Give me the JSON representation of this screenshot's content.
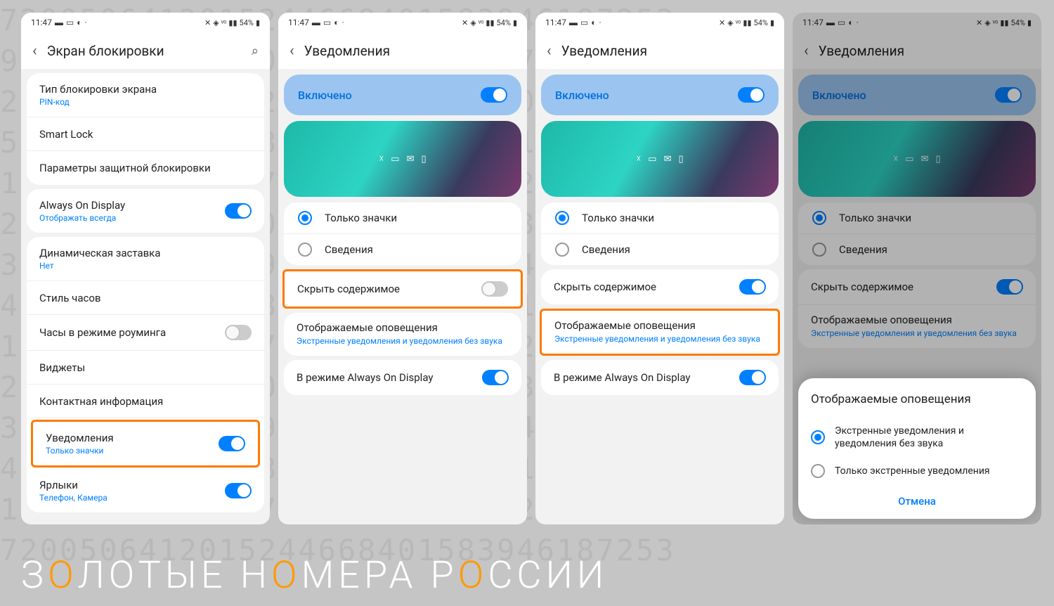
{
  "statusbar": {
    "time": "11:47",
    "battery": "54%"
  },
  "screen1": {
    "title": "Экран блокировки",
    "items": {
      "lock_type": {
        "title": "Тип блокировки экрана",
        "sub": "PIN-код"
      },
      "smart_lock": "Smart Lock",
      "secure_params": "Параметры защитной блокировки",
      "aod": {
        "title": "Always On Display",
        "sub": "Отображать всегда"
      },
      "dynamic": {
        "title": "Динамическая заставка",
        "sub": "Нет"
      },
      "clock_style": "Стиль часов",
      "roaming_clock": "Часы в режиме роуминга",
      "widgets": "Виджеты",
      "contact_info": "Контактная информация",
      "notifications": {
        "title": "Уведомления",
        "sub": "Только значки"
      },
      "shortcuts": {
        "title": "Ярлыки",
        "sub": "Телефон, Камера"
      }
    }
  },
  "notif_screen": {
    "title": "Уведомления",
    "enabled": "Включено",
    "radio_icons": "Только значки",
    "radio_details": "Сведения",
    "hide_content": "Скрыть содержимое",
    "shown_alerts": {
      "title": "Отображаемые оповещения",
      "sub": "Экстренные уведомления и уведомления без звука"
    },
    "aod_mode": "В режиме Always On Display"
  },
  "dialog": {
    "title": "Отображаемые оповещения",
    "opt1": "Экстренные уведомления и уведомления без звука",
    "opt2": "Только экстренные уведомления",
    "cancel": "Отмена"
  },
  "footer": {
    "p1": "З",
    "p2": "О",
    "p3": "ЛОТЫЕ Н",
    "p4": "О",
    "p5": "МЕРА Р",
    "p6": "О",
    "p7": "ССИИ"
  }
}
